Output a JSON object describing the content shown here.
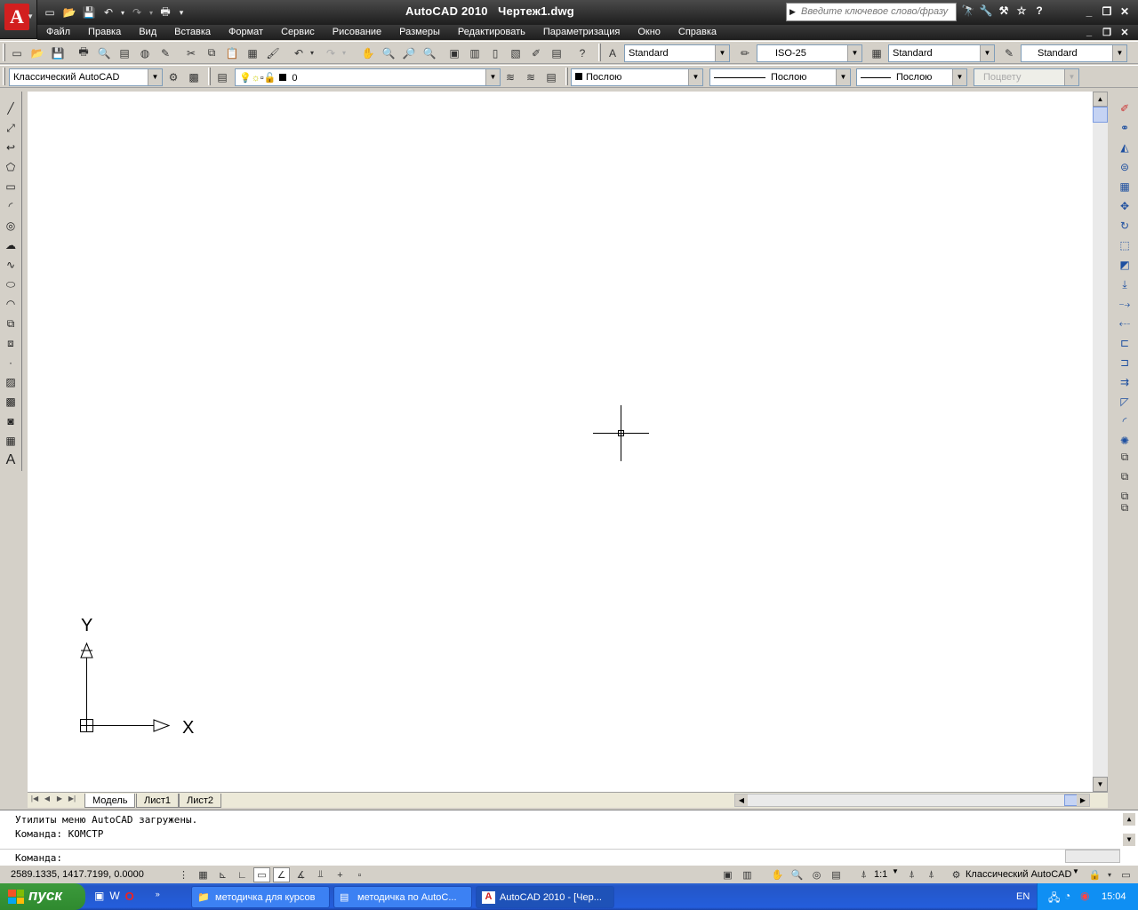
{
  "window": {
    "app_name": "AutoCAD 2010",
    "doc_name": "Чертеж1.dwg",
    "search_placeholder": "Введите ключевое слово/фразу"
  },
  "menu": [
    "Файл",
    "Правка",
    "Вид",
    "Вставка",
    "Формат",
    "Сервис",
    "Рисование",
    "Размеры",
    "Редактировать",
    "Параметризация",
    "Окно",
    "Справка"
  ],
  "styles": {
    "text_style": "Standard",
    "dim_style": "ISO-25",
    "table_style": "Standard",
    "mleader_style": "Standard"
  },
  "layers": {
    "workspace": "Классический AutoCAD",
    "current_layer": "0"
  },
  "properties": {
    "color": "Послою",
    "linetype": "Послою",
    "lineweight": "Послою",
    "plotstyle": "Поцвету"
  },
  "ucs": {
    "x_label": "X",
    "y_label": "Y"
  },
  "tabs": [
    "Модель",
    "Лист1",
    "Лист2"
  ],
  "command": {
    "history": [
      "Утилиты меню AutoCAD загружены.",
      "Команда: КОМСТР"
    ],
    "prompt": "Команда:"
  },
  "status": {
    "coords": "2589.1335, 1417.7199, 0.0000",
    "anno_scale": "1:1",
    "workspace": "Классический AutoCAD"
  },
  "taskbar": {
    "start_label": "пуск",
    "tasks": [
      "методичка для курсов",
      "методичка по AutoC...",
      "AutoCAD 2010 - [Чер..."
    ],
    "lang": "EN",
    "clock": "15:04"
  },
  "colors": {
    "accent": "#d21f1f",
    "taskbar": "#245edc",
    "start": "#3c9a3c"
  }
}
